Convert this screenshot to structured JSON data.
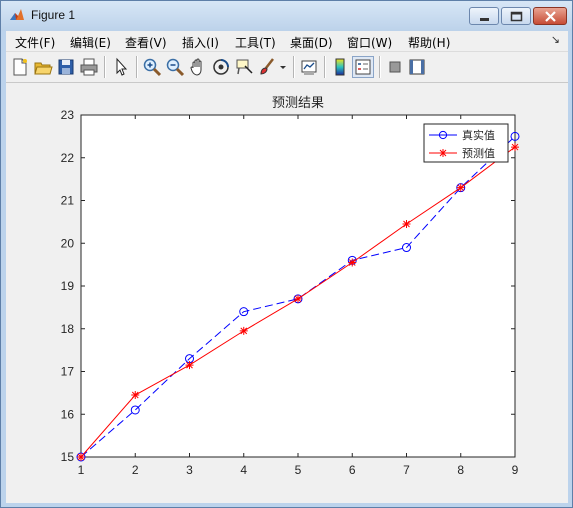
{
  "window": {
    "title": "Figure 1"
  },
  "menubar": {
    "items": [
      "文件(F)",
      "编辑(E)",
      "查看(V)",
      "插入(I)",
      "工具(T)",
      "桌面(D)",
      "窗口(W)",
      "帮助(H)"
    ],
    "overflow_arrow": "↘"
  },
  "toolbar": {
    "icons": [
      "new-figure-icon",
      "open-file-icon",
      "save-icon",
      "print-icon",
      "pointer-icon",
      "zoom-in-icon",
      "zoom-out-icon",
      "pan-icon",
      "rotate-3d-icon",
      "data-cursor-icon",
      "brush-icon",
      "brush-dropdown-icon",
      "link-plot-icon",
      "insert-colorbar-icon",
      "insert-legend-icon",
      "hide-plot-tools-icon",
      "show-plot-tools-icon"
    ]
  },
  "chart_data": {
    "type": "line",
    "title": "预测结果",
    "xlabel": "",
    "ylabel": "",
    "x": [
      1,
      2,
      3,
      4,
      5,
      6,
      7,
      8,
      9
    ],
    "xlim": [
      1,
      9
    ],
    "ylim": [
      15,
      23
    ],
    "xticks": [
      1,
      2,
      3,
      4,
      5,
      6,
      7,
      8,
      9
    ],
    "yticks": [
      15,
      16,
      17,
      18,
      19,
      20,
      21,
      22,
      23
    ],
    "grid": false,
    "legend_position": "top-right",
    "series": [
      {
        "name": "真实值",
        "values": [
          15.0,
          16.1,
          17.3,
          18.4,
          18.7,
          19.6,
          19.9,
          21.3,
          22.5
        ],
        "color": "#0000ff",
        "line_style": "dashed",
        "marker": "circle"
      },
      {
        "name": "预测值",
        "values": [
          15.0,
          16.45,
          17.15,
          17.95,
          18.7,
          19.55,
          20.45,
          21.3,
          22.25
        ],
        "color": "#ff0000",
        "line_style": "solid",
        "marker": "asterisk"
      }
    ]
  }
}
